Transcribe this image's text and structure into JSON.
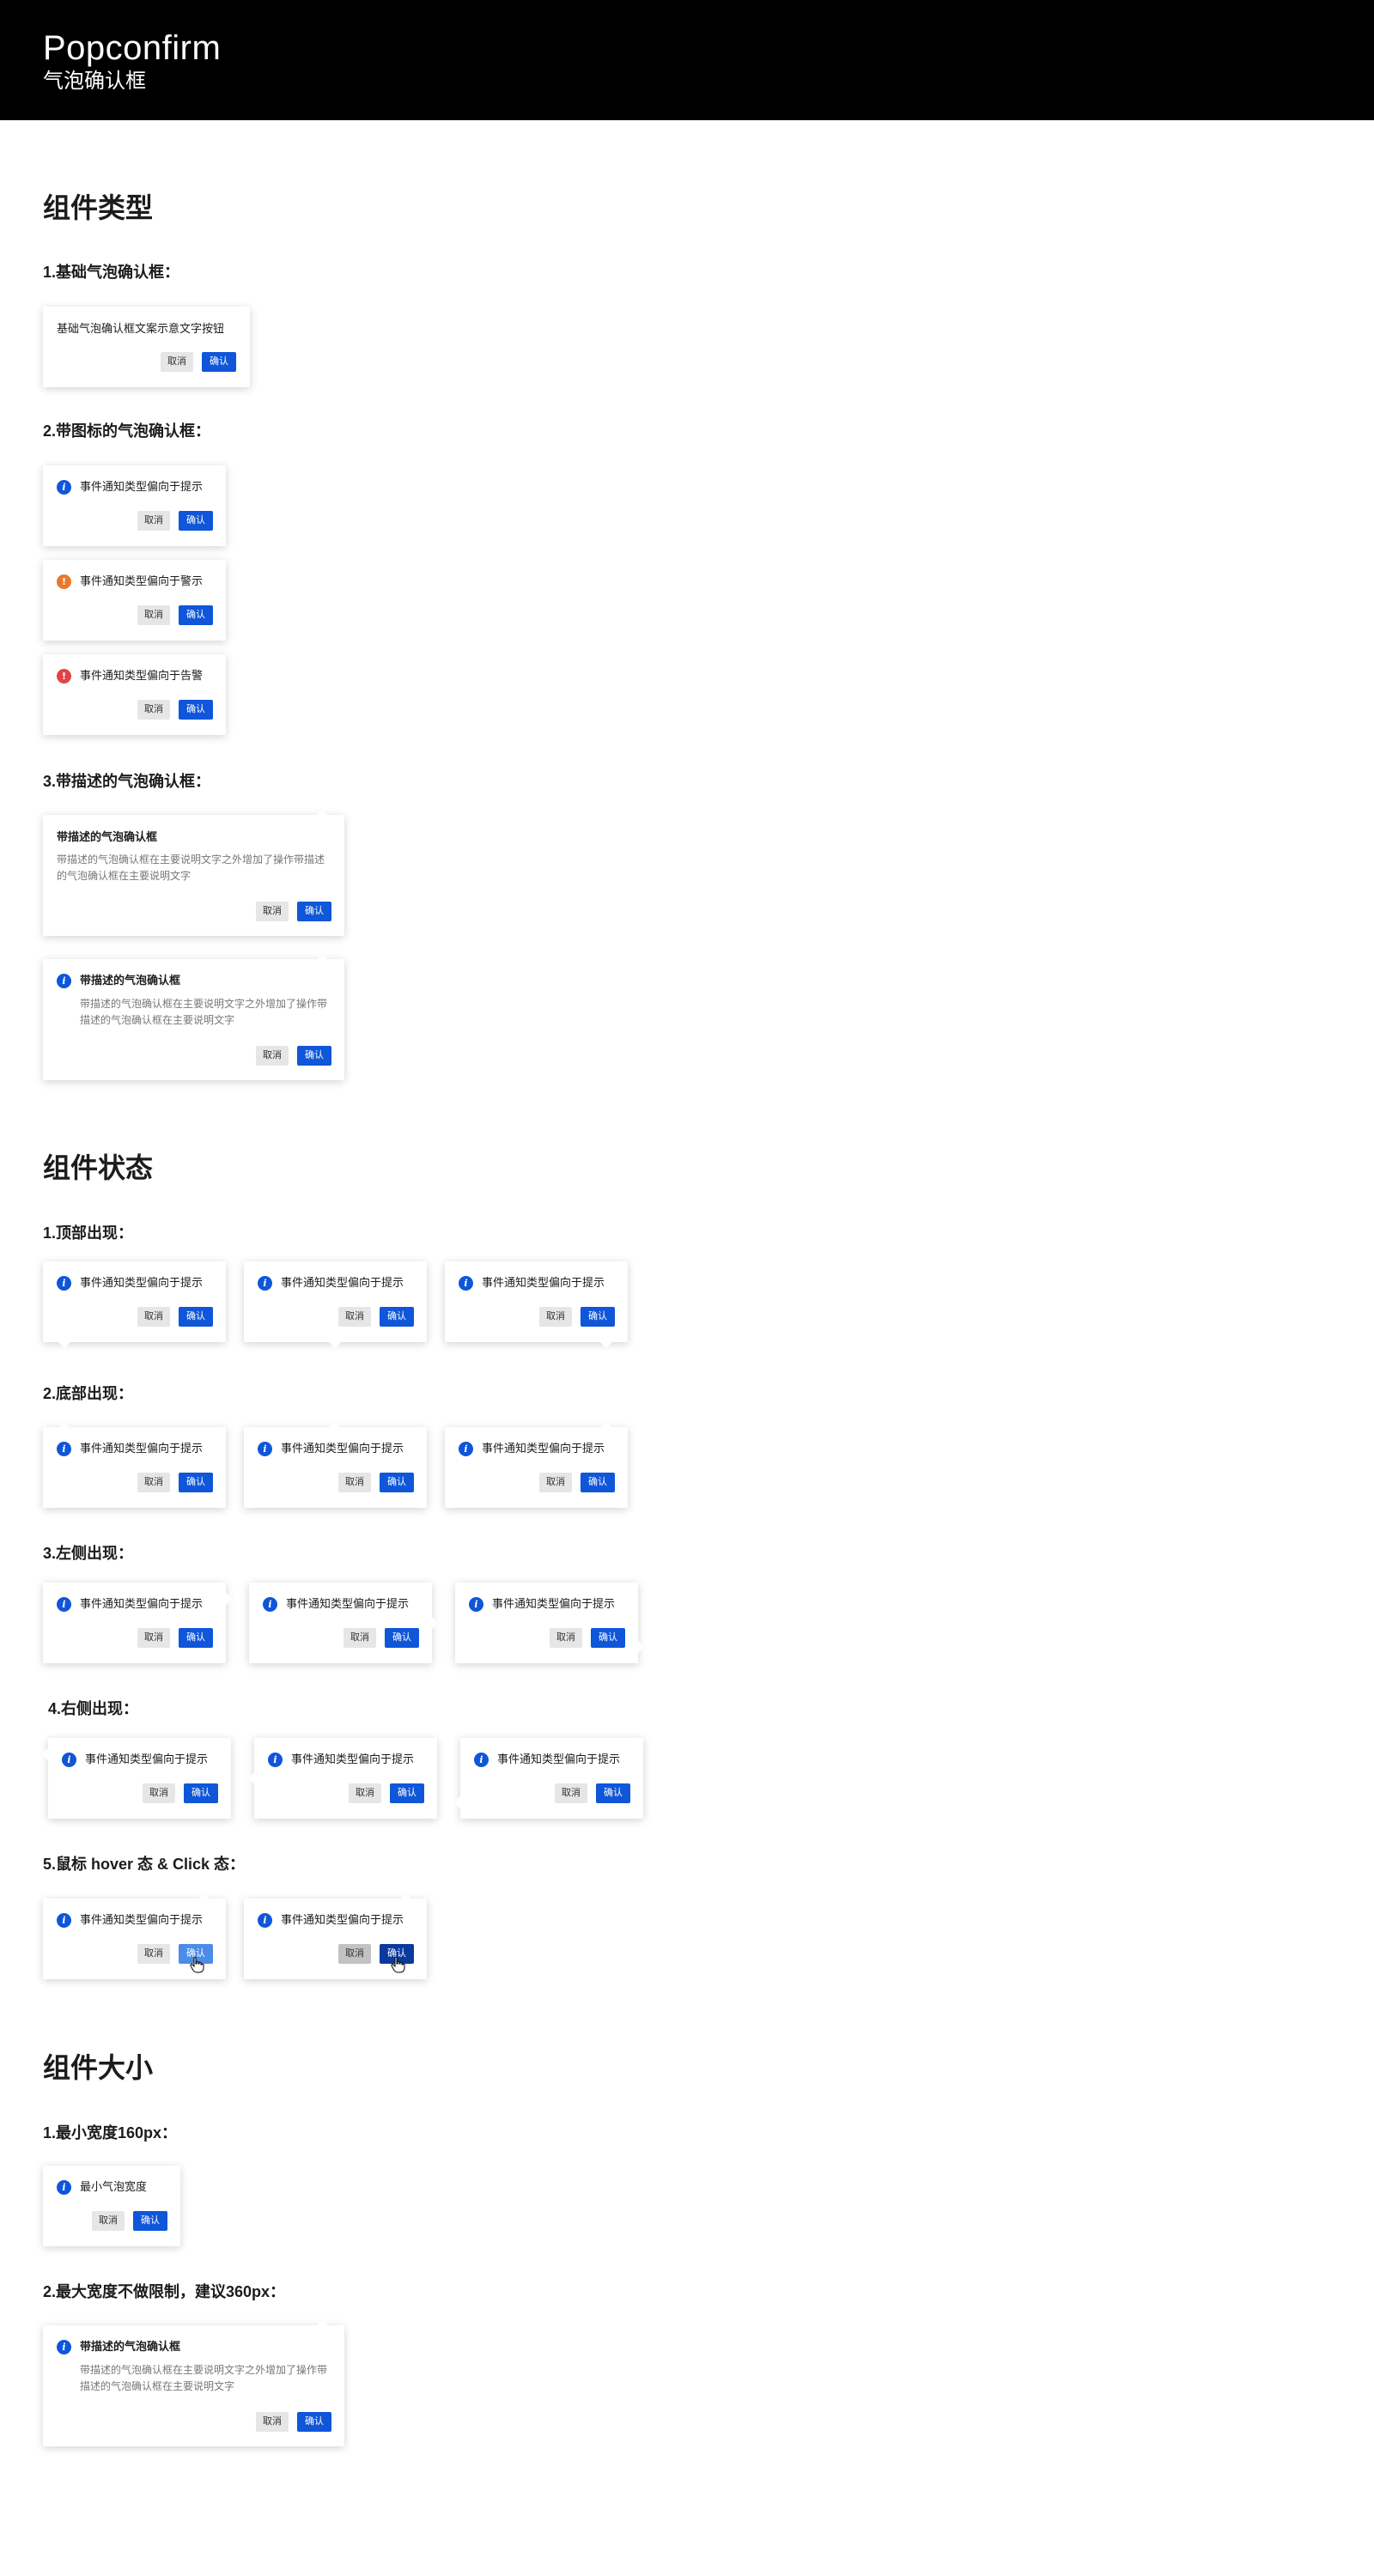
{
  "header": {
    "title": "Popconfirm",
    "subtitle": "气泡确认框"
  },
  "labels": {
    "cancel": "取消",
    "confirm": "确认"
  },
  "colors": {
    "primary": "#0f56d9",
    "warning": "#e8792b",
    "error": "#e04545"
  },
  "types": {
    "title": "组件类型",
    "basic": {
      "label": "1.基础气泡确认框：",
      "text": "基础气泡确认框文案示意文字按钮"
    },
    "with_icon": {
      "label": "2.带图标的气泡确认框：",
      "items": [
        {
          "icon": "info-icon",
          "text": "事件通知类型偏向于提示"
        },
        {
          "icon": "warning-icon",
          "text": "事件通知类型偏向于警示"
        },
        {
          "icon": "error-icon",
          "text": "事件通知类型偏向于告警"
        }
      ]
    },
    "with_desc": {
      "label": "3.带描述的气泡确认框：",
      "plain": {
        "title": "带描述的气泡确认框",
        "desc": [
          "带描述的气泡确认框在主要说明文字之外增加了操作带描述",
          "的气泡确认框在主要说明文字"
        ]
      },
      "icon": {
        "title": "带描述的气泡确认框",
        "desc": [
          "带描述的气泡确认框在主要说明文字之外增加了操作带",
          "描述的气泡确认框在主要说明文字"
        ]
      }
    }
  },
  "states": {
    "title": "组件状态",
    "message": "事件通知类型偏向于提示",
    "top": {
      "label": "1.顶部出现："
    },
    "bottom": {
      "label": "2.底部出现："
    },
    "left": {
      "label": "3.左侧出现："
    },
    "right": {
      "label": "4.右侧出现："
    },
    "hover_click": {
      "label": "5.鼠标 hover 态 & Click 态："
    }
  },
  "sizes": {
    "title": "组件大小",
    "min": {
      "label": "1.最小宽度160px：",
      "text": "最小气泡宽度"
    },
    "max": {
      "label": "2.最大宽度不做限制，建议360px：",
      "title": "带描述的气泡确认框",
      "desc": [
        "带描述的气泡确认框在主要说明文字之外增加了操作带",
        "描述的气泡确认框在主要说明文字"
      ]
    }
  }
}
